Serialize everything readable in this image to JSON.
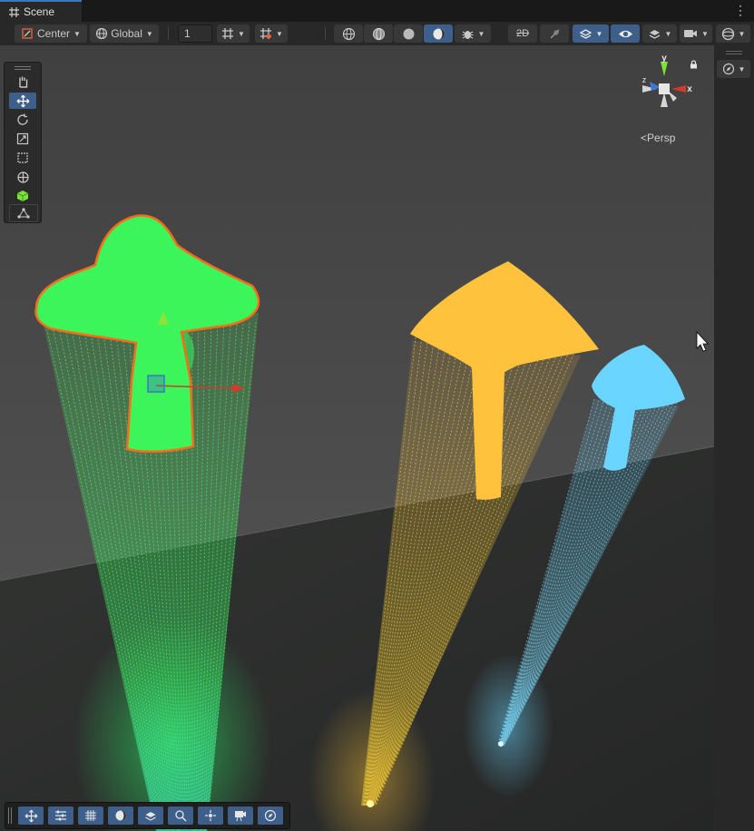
{
  "tab": {
    "title": "Scene"
  },
  "toolbar": {
    "pivot_label": "Center",
    "space_label": "Global",
    "grid_snap_value": "1",
    "scene_view_2d_label": "2D"
  },
  "gizmo": {
    "projection_label": "Persp",
    "axis_y": "y",
    "axis_x": "x",
    "axis_z": "z"
  },
  "colors": {
    "green": "#3ef060",
    "green_outline": "#ff6a1a",
    "orange": "#ffc13a",
    "cyan": "#5fd2ff",
    "accent": "#3e5f8a"
  },
  "tools": [
    "hand-icon",
    "move-icon",
    "rotate-icon",
    "scale-icon",
    "rect-icon",
    "transform-icon",
    "cube-icon",
    "custom-tool-icon"
  ],
  "bottom_tools": [
    "move-icon",
    "sliders-icon",
    "grid-icon",
    "lighting-icon",
    "layers-icon",
    "search-icon",
    "pivot-icon",
    "camera-icon",
    "compass-icon"
  ]
}
